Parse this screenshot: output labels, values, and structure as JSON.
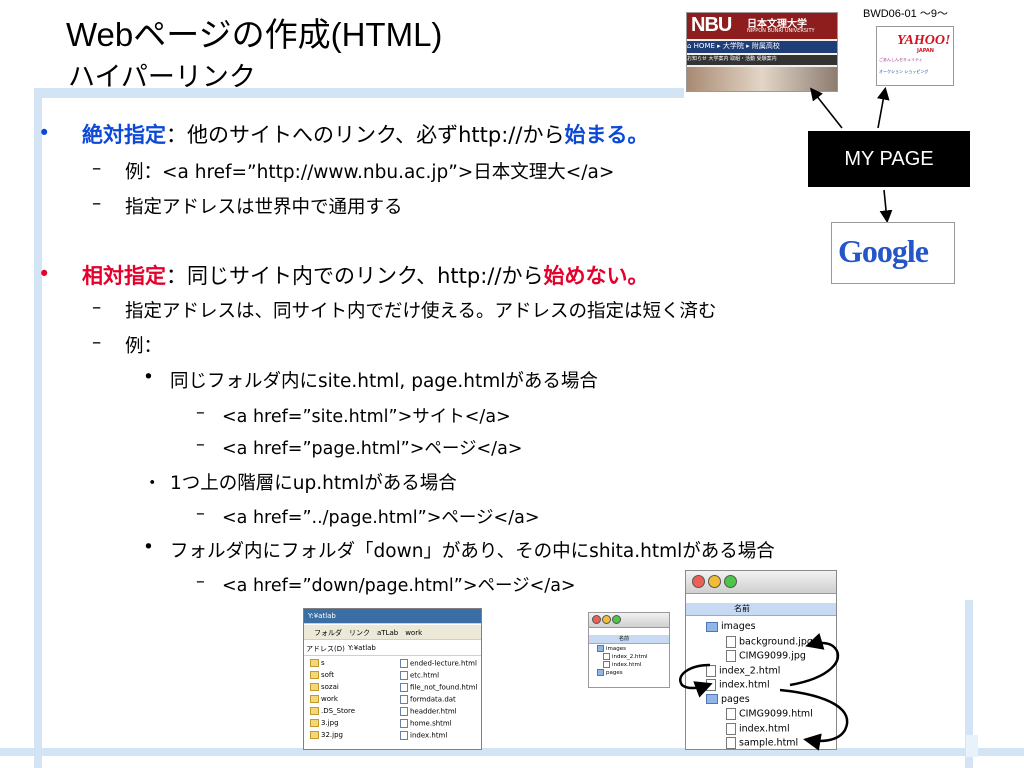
{
  "slide": {
    "tag": "BWD06-01 ～9～",
    "title": "Webページの作成(HTML)",
    "subtitle": "ハイパーリンク"
  },
  "content": {
    "absolute": {
      "bullet": "•",
      "keyword": "絶対指定",
      "text_a": "：他のサイトへのリンク、必ずhttp://から",
      "emphasis": "始まる。",
      "dash": "–",
      "ex_text": "例：<a href=”http://www.nbu.ac.jp”>日本文理大</a>",
      "ex2_text": "指定アドレスは世界中で通用する"
    },
    "relative": {
      "bullet": "•",
      "keyword": "相対指定",
      "text_a": "：同じサイト内でのリンク、http://から",
      "emphasis": "始めない。",
      "dash": "–",
      "item1": "指定アドレスは、同サイト内でだけ使える。アドレスの指定は短く済む",
      "item2": "例：",
      "sub_bullet": "•",
      "sub_bullet_alt": "・",
      "sub_dash": "–",
      "case1": "同じフォルダ内にsite.html, page.htmlがある場合",
      "case1_ex1": "<a href=”site.html”>サイト</a>",
      "case1_ex2": "<a href=”page.html”>ページ</a>",
      "case2": "1つ上の階層にup.htmlがある場合",
      "case2_ex1": "<a href=”../page.html”>ページ</a>",
      "case3": "フォルダ内にフォルダ「down」があり、その中にshita.htmlがある場合",
      "case3_ex1": "<a href=”down/page.html”>ページ</a>"
    }
  },
  "diagram": {
    "mypage_label": "MY PAGE",
    "nbu": {
      "logo": "NBU",
      "jp": "日本文理大学",
      "en": "NIPPON BUNRI UNIVERSITY",
      "nav": "⌂ HOME ▸ 大学院 ▸ 附属高校",
      "nav2": "お知らせ 大学案内 取組・活動 受験案内"
    },
    "yahoo": {
      "logo": "YAHOO!",
      "jp": "JAPAN",
      "text": "ごあんしんセキュリティ",
      "text2": "オークション ショッピング"
    },
    "google": {
      "logo": "Google"
    }
  },
  "explorer": {
    "path": "Y:¥atlab",
    "toolbar": "フォルダ　リンク　aTLab　work",
    "address_label": "アドレス(D)",
    "address": "Y:¥atlab",
    "left_items": [
      "s",
      "soft",
      "sozai",
      "work",
      ".DS_Store",
      "3.jpg",
      "32.jpg"
    ],
    "right_items": [
      "ended-lecture.html",
      "etc.html",
      "file_not_found.html",
      "formdata.dat",
      "headder.html",
      "home.shtml",
      "index.html"
    ]
  },
  "mac_small": {
    "header": "名前",
    "items": [
      "images",
      "index_2.html",
      "index.html",
      "pages"
    ]
  },
  "mac_big": {
    "header": "名前",
    "items": [
      "images",
      "background.jpg",
      "CIMG9099.jpg",
      "index_2.html",
      "index.html",
      "pages",
      "CIMG9099.html",
      "index.html",
      "sample.html"
    ]
  },
  "colors": {
    "red": "#e4002b",
    "blue": "#0b49d6",
    "frame": "#d3e4f4"
  }
}
